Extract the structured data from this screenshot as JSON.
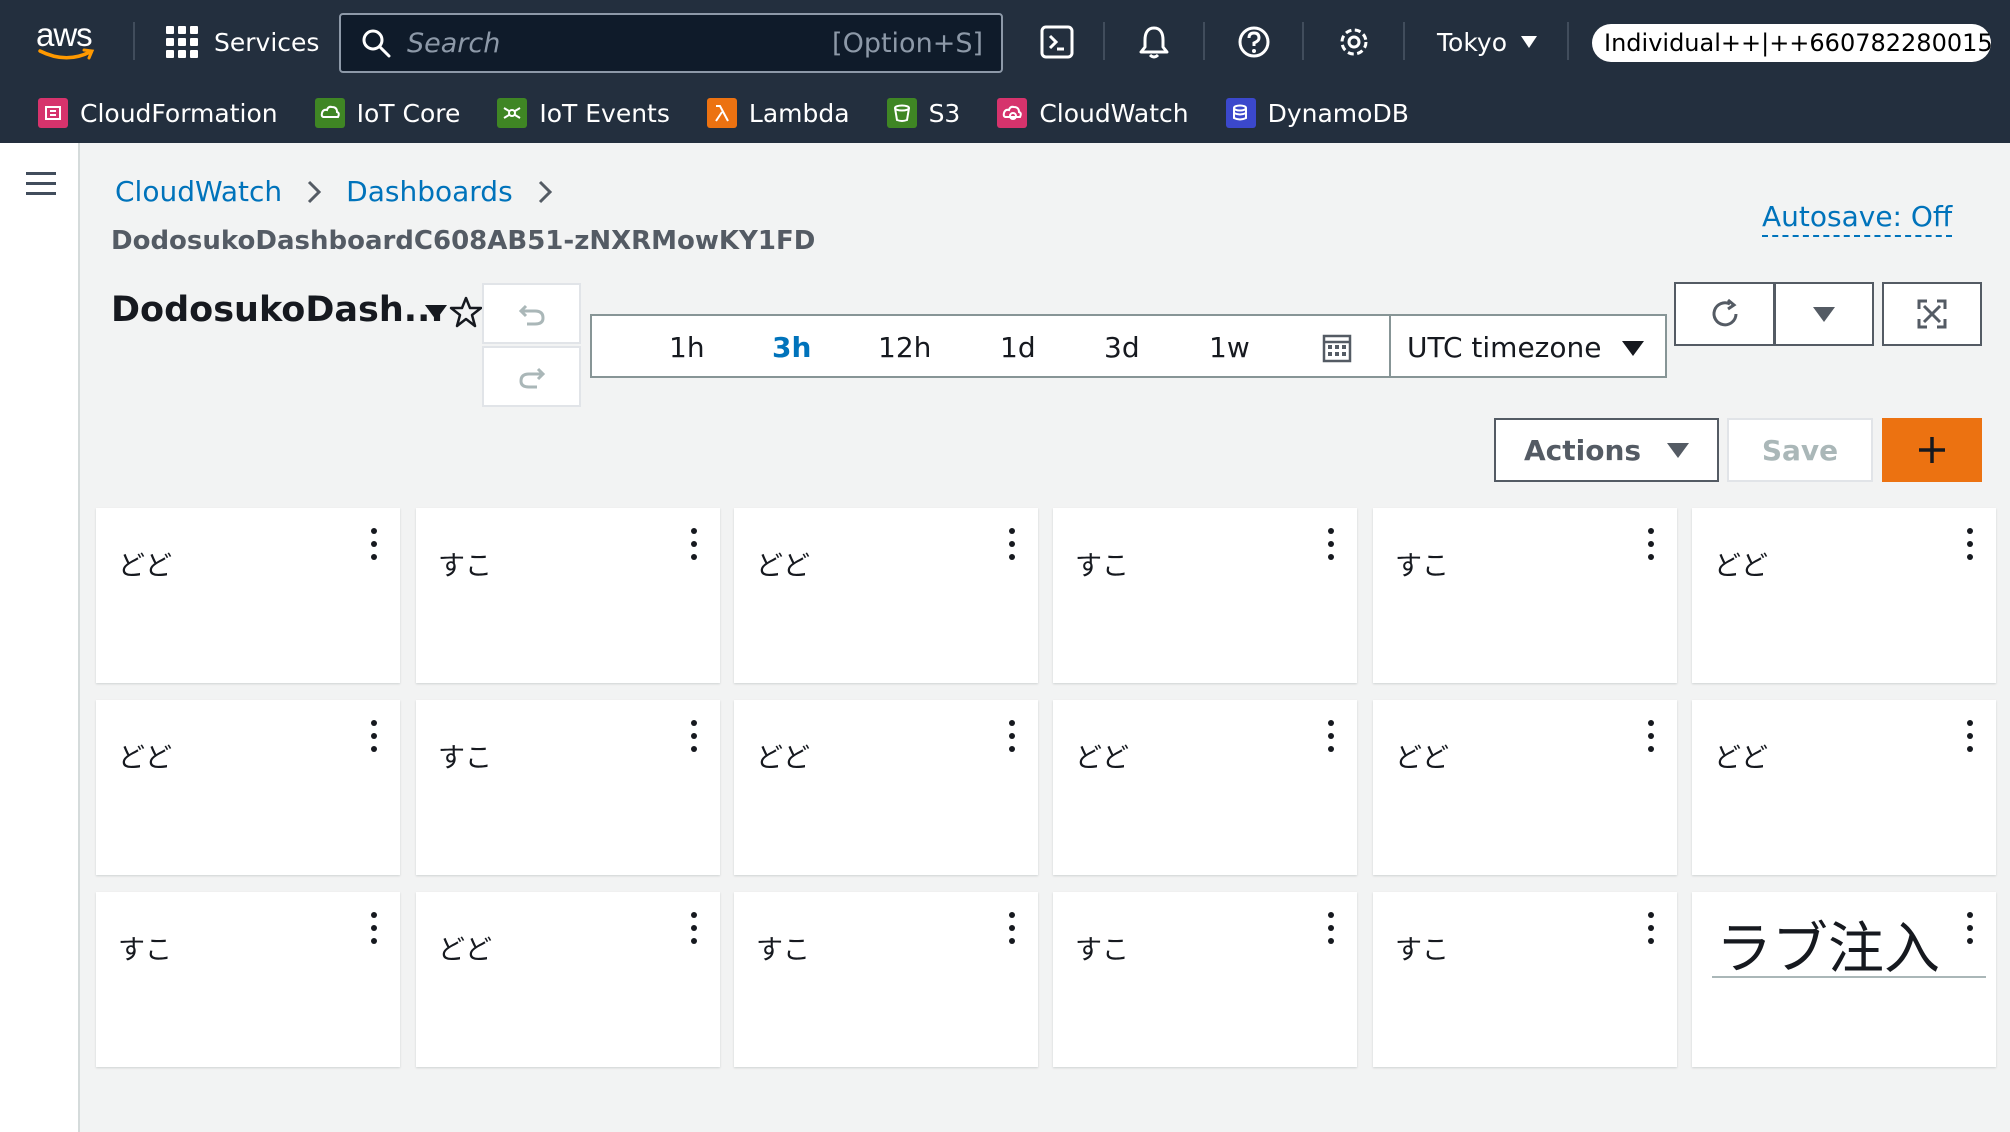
{
  "nav": {
    "logo_text": "aws",
    "services_label": "Services",
    "search_placeholder": "Search",
    "search_shortcut": "[Option+S]",
    "region": "Tokyo",
    "account": "Individual++|++660782280015",
    "favorites": [
      {
        "label": "CloudFormation",
        "color": "#d6336c"
      },
      {
        "label": "IoT Core",
        "color": "#3f8624"
      },
      {
        "label": "IoT Events",
        "color": "#3f8624"
      },
      {
        "label": "Lambda",
        "color": "#ec7211"
      },
      {
        "label": "S3",
        "color": "#3f8624"
      },
      {
        "label": "CloudWatch",
        "color": "#d6336c"
      },
      {
        "label": "DynamoDB",
        "color": "#3b48cc"
      }
    ]
  },
  "breadcrumb": {
    "items": [
      "CloudWatch",
      "Dashboards"
    ],
    "current": "DodosukoDashboardC608AB51-zNXRMowKY1FD"
  },
  "header": {
    "autosave": "Autosave: Off",
    "title": "DodosukoDash..."
  },
  "timerange": {
    "options": [
      "1h",
      "3h",
      "12h",
      "1d",
      "3d",
      "1w"
    ],
    "active": "3h",
    "timezone": "UTC timezone"
  },
  "toolbar": {
    "actions_label": "Actions",
    "save_label": "Save"
  },
  "widgets": [
    "どど",
    "すこ",
    "どど",
    "すこ",
    "すこ",
    "どど",
    "どど",
    "すこ",
    "どど",
    "どど",
    "どど",
    "どど",
    "すこ",
    "どど",
    "すこ",
    "すこ",
    "すこ",
    "ラブ注入"
  ],
  "colors": {
    "nav_bg": "#232f3e",
    "link": "#0073bb",
    "primary": "#ec7211",
    "page_bg": "#f2f3f3"
  }
}
